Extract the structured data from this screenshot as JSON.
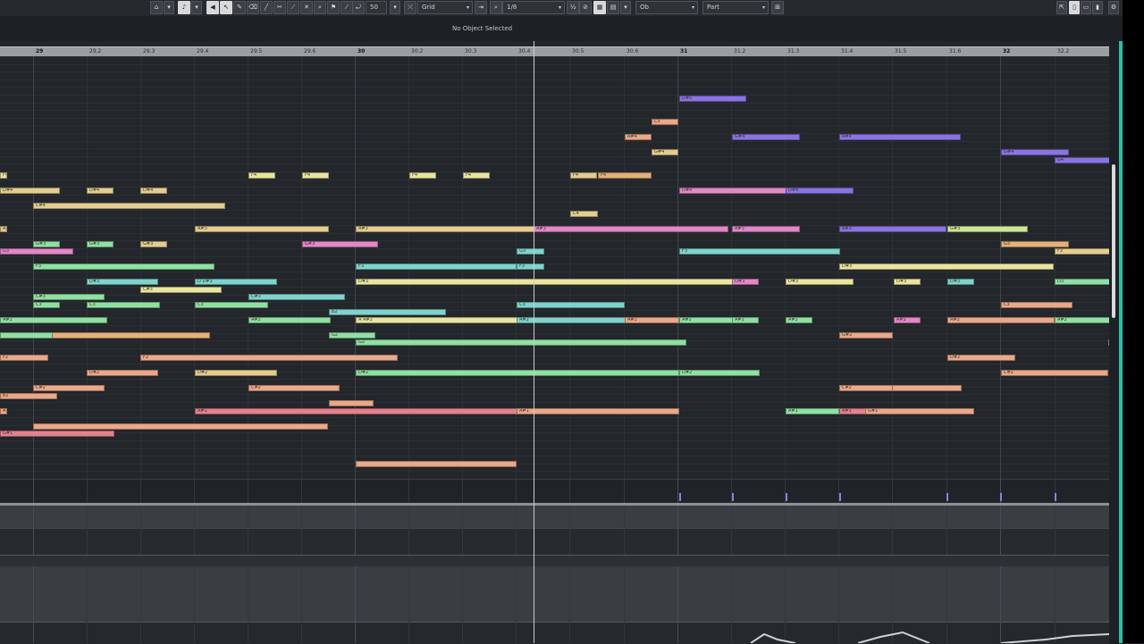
{
  "toolbar": {
    "quantize_value": "50",
    "grid_label": "Grid",
    "quantize_label": "1/8",
    "track_label": "Ob",
    "part_label": "Part"
  },
  "info": {
    "status": "No Object Selected"
  },
  "ruler": {
    "labels": [
      "29",
      "29.2",
      "29.3",
      "29.4",
      "29.5",
      "29.6",
      "30",
      "30.2",
      "30.3",
      "30.4",
      "30.5",
      "30.6",
      "31",
      "31.2",
      "31.3",
      "31.4",
      "31.5",
      "31.6",
      "32",
      "32.2"
    ]
  },
  "colors": {
    "yellow": "#e9e5a0",
    "orange": "#e6b07a",
    "sand": "#e4cd8f",
    "salmon": "#e9a889",
    "red": "#e2828f",
    "pink": "#e287c8",
    "purple": "#8a74e3",
    "cyan": "#7fd3cc",
    "green": "#8fe0a2",
    "lime": "#cbe897"
  },
  "notes": [
    {
      "label": "D#5",
      "color": "purple"
    },
    {
      "label": "C5",
      "color": "salmon"
    },
    {
      "label": "A#4",
      "color": "salmon"
    },
    {
      "label": "G#4",
      "color": "purple"
    },
    {
      "label": "A#4",
      "color": "purple"
    },
    {
      "label": "G#4",
      "color": "sand"
    },
    {
      "label": "G#4",
      "color": "purple"
    },
    {
      "label": "G4",
      "color": "purple"
    },
    {
      "label": "F4",
      "color": "yellow"
    },
    {
      "label": "F4",
      "color": "yellow"
    },
    {
      "label": "F4",
      "color": "yellow"
    },
    {
      "label": "F4",
      "color": "yellow"
    },
    {
      "label": "F4",
      "color": "yellow"
    },
    {
      "label": "F4",
      "color": "sand"
    },
    {
      "label": "F4",
      "color": "orange"
    },
    {
      "label": "D#4",
      "color": "sand"
    },
    {
      "label": "D#4",
      "color": "sand"
    },
    {
      "label": "D#4",
      "color": "sand"
    },
    {
      "label": "D#4",
      "color": "pink"
    },
    {
      "label": "D#4",
      "color": "purple"
    },
    {
      "label": "C#4",
      "color": "sand"
    },
    {
      "label": "C4",
      "color": "sand"
    },
    {
      "label": "A#3",
      "color": "sand"
    },
    {
      "label": "A#3",
      "color": "sand"
    },
    {
      "label": "A#3",
      "color": "sand"
    },
    {
      "label": "A#3",
      "color": "pink"
    },
    {
      "label": "A#3",
      "color": "pink"
    },
    {
      "label": "A#3",
      "color": "purple"
    },
    {
      "label": "G#3",
      "color": "lime"
    },
    {
      "label": "G#3",
      "color": "green"
    },
    {
      "label": "G#3",
      "color": "green"
    },
    {
      "label": "G#3",
      "color": "sand"
    },
    {
      "label": "G#3",
      "color": "pink"
    },
    {
      "label": "G3",
      "color": "orange"
    },
    {
      "label": "G3",
      "color": "cyan"
    },
    {
      "label": "G3",
      "color": "pink"
    },
    {
      "label": "F3",
      "color": "cyan"
    },
    {
      "label": "F3",
      "color": "sand"
    },
    {
      "label": "F3",
      "color": "green"
    },
    {
      "label": "F3",
      "color": "cyan"
    },
    {
      "label": "F3",
      "color": "cyan"
    },
    {
      "label": "D#3",
      "color": "yellow"
    },
    {
      "label": "D#3",
      "color": "cyan"
    },
    {
      "label": "D D#3",
      "color": "cyan"
    },
    {
      "label": "D#3",
      "color": "yellow"
    },
    {
      "label": "D#3",
      "color": "pink"
    },
    {
      "label": "D#3",
      "color": "yellow"
    },
    {
      "label": "D#3",
      "color": "yellow"
    },
    {
      "label": "D#3",
      "color": "cyan"
    },
    {
      "label": "D3",
      "color": "green"
    },
    {
      "label": "C#3",
      "color": "yellow"
    },
    {
      "label": "C#3",
      "color": "green"
    },
    {
      "label": "C#3",
      "color": "cyan"
    },
    {
      "label": "C3",
      "color": "green"
    },
    {
      "label": "C3",
      "color": "green"
    },
    {
      "label": "C3",
      "color": "green"
    },
    {
      "label": "C3",
      "color": "cyan"
    },
    {
      "label": "C3",
      "color": "salmon"
    },
    {
      "label": "B2",
      "color": "cyan"
    },
    {
      "label": "A#2",
      "color": "green"
    },
    {
      "label": "A#2",
      "color": "green"
    },
    {
      "label": "A A#2",
      "color": "yellow"
    },
    {
      "label": "A#2",
      "color": "cyan"
    },
    {
      "label": "A#2",
      "color": "salmon"
    },
    {
      "label": "A#2",
      "color": "green"
    },
    {
      "label": "A#2",
      "color": "green"
    },
    {
      "label": "A#2",
      "color": "green"
    },
    {
      "label": "A#2",
      "color": "pink"
    },
    {
      "label": "A#2",
      "color": "salmon"
    },
    {
      "label": "A#2",
      "color": "green"
    },
    {
      "label": "",
      "color": "green"
    },
    {
      "label": "",
      "color": "orange"
    },
    {
      "label": "G2",
      "color": "green"
    },
    {
      "label": "G2",
      "color": "green"
    },
    {
      "label": "G#2",
      "color": "salmon"
    },
    {
      "label": "",
      "color": "orange"
    },
    {
      "label": "F2",
      "color": "salmon"
    },
    {
      "label": "F2",
      "color": "salmon"
    },
    {
      "label": "D#2",
      "color": "salmon"
    },
    {
      "label": "D#2",
      "color": "salmon"
    },
    {
      "label": "D#2",
      "color": "sand"
    },
    {
      "label": "D#2",
      "color": "green"
    },
    {
      "label": "D#2",
      "color": "green"
    },
    {
      "label": "C#2",
      "color": "salmon"
    },
    {
      "label": "C#2",
      "color": "salmon"
    },
    {
      "label": "C#2",
      "color": "salmon"
    },
    {
      "label": "C#2",
      "color": "salmon"
    },
    {
      "label": "",
      "color": "salmon"
    },
    {
      "label": "B1",
      "color": "salmon"
    },
    {
      "label": "",
      "color": "salmon"
    },
    {
      "label": "A#1",
      "color": "salmon"
    },
    {
      "label": "A#1",
      "color": "red"
    },
    {
      "label": "A#1",
      "color": "salmon"
    },
    {
      "label": "A#1",
      "color": "green"
    },
    {
      "label": "A#1",
      "color": "red"
    },
    {
      "label": "G#1",
      "color": "salmon"
    },
    {
      "label": "",
      "color": "salmon"
    },
    {
      "label": "G#1",
      "color": "red"
    },
    {
      "label": "",
      "color": "salmon"
    }
  ]
}
